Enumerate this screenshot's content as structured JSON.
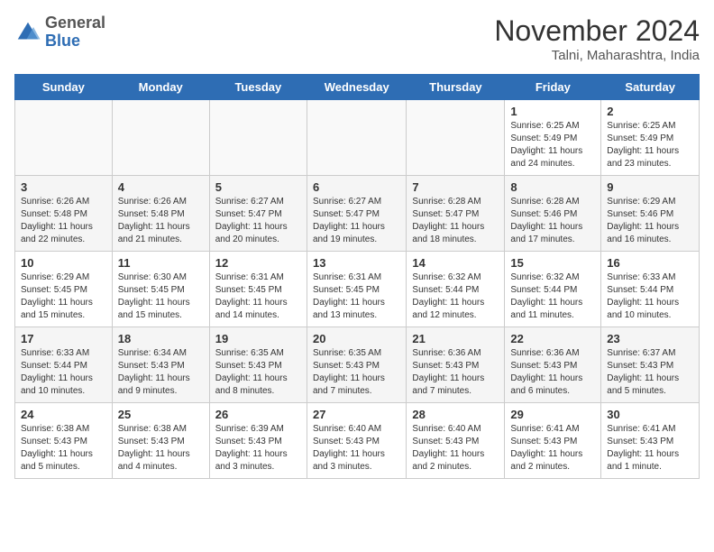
{
  "header": {
    "logo_general": "General",
    "logo_blue": "Blue",
    "month_title": "November 2024",
    "location": "Talni, Maharashtra, India"
  },
  "weekdays": [
    "Sunday",
    "Monday",
    "Tuesday",
    "Wednesday",
    "Thursday",
    "Friday",
    "Saturday"
  ],
  "weeks": [
    [
      {
        "day": "",
        "info": ""
      },
      {
        "day": "",
        "info": ""
      },
      {
        "day": "",
        "info": ""
      },
      {
        "day": "",
        "info": ""
      },
      {
        "day": "",
        "info": ""
      },
      {
        "day": "1",
        "info": "Sunrise: 6:25 AM\nSunset: 5:49 PM\nDaylight: 11 hours and 24 minutes."
      },
      {
        "day": "2",
        "info": "Sunrise: 6:25 AM\nSunset: 5:49 PM\nDaylight: 11 hours and 23 minutes."
      }
    ],
    [
      {
        "day": "3",
        "info": "Sunrise: 6:26 AM\nSunset: 5:48 PM\nDaylight: 11 hours and 22 minutes."
      },
      {
        "day": "4",
        "info": "Sunrise: 6:26 AM\nSunset: 5:48 PM\nDaylight: 11 hours and 21 minutes."
      },
      {
        "day": "5",
        "info": "Sunrise: 6:27 AM\nSunset: 5:47 PM\nDaylight: 11 hours and 20 minutes."
      },
      {
        "day": "6",
        "info": "Sunrise: 6:27 AM\nSunset: 5:47 PM\nDaylight: 11 hours and 19 minutes."
      },
      {
        "day": "7",
        "info": "Sunrise: 6:28 AM\nSunset: 5:47 PM\nDaylight: 11 hours and 18 minutes."
      },
      {
        "day": "8",
        "info": "Sunrise: 6:28 AM\nSunset: 5:46 PM\nDaylight: 11 hours and 17 minutes."
      },
      {
        "day": "9",
        "info": "Sunrise: 6:29 AM\nSunset: 5:46 PM\nDaylight: 11 hours and 16 minutes."
      }
    ],
    [
      {
        "day": "10",
        "info": "Sunrise: 6:29 AM\nSunset: 5:45 PM\nDaylight: 11 hours and 15 minutes."
      },
      {
        "day": "11",
        "info": "Sunrise: 6:30 AM\nSunset: 5:45 PM\nDaylight: 11 hours and 15 minutes."
      },
      {
        "day": "12",
        "info": "Sunrise: 6:31 AM\nSunset: 5:45 PM\nDaylight: 11 hours and 14 minutes."
      },
      {
        "day": "13",
        "info": "Sunrise: 6:31 AM\nSunset: 5:45 PM\nDaylight: 11 hours and 13 minutes."
      },
      {
        "day": "14",
        "info": "Sunrise: 6:32 AM\nSunset: 5:44 PM\nDaylight: 11 hours and 12 minutes."
      },
      {
        "day": "15",
        "info": "Sunrise: 6:32 AM\nSunset: 5:44 PM\nDaylight: 11 hours and 11 minutes."
      },
      {
        "day": "16",
        "info": "Sunrise: 6:33 AM\nSunset: 5:44 PM\nDaylight: 11 hours and 10 minutes."
      }
    ],
    [
      {
        "day": "17",
        "info": "Sunrise: 6:33 AM\nSunset: 5:44 PM\nDaylight: 11 hours and 10 minutes."
      },
      {
        "day": "18",
        "info": "Sunrise: 6:34 AM\nSunset: 5:43 PM\nDaylight: 11 hours and 9 minutes."
      },
      {
        "day": "19",
        "info": "Sunrise: 6:35 AM\nSunset: 5:43 PM\nDaylight: 11 hours and 8 minutes."
      },
      {
        "day": "20",
        "info": "Sunrise: 6:35 AM\nSunset: 5:43 PM\nDaylight: 11 hours and 7 minutes."
      },
      {
        "day": "21",
        "info": "Sunrise: 6:36 AM\nSunset: 5:43 PM\nDaylight: 11 hours and 7 minutes."
      },
      {
        "day": "22",
        "info": "Sunrise: 6:36 AM\nSunset: 5:43 PM\nDaylight: 11 hours and 6 minutes."
      },
      {
        "day": "23",
        "info": "Sunrise: 6:37 AM\nSunset: 5:43 PM\nDaylight: 11 hours and 5 minutes."
      }
    ],
    [
      {
        "day": "24",
        "info": "Sunrise: 6:38 AM\nSunset: 5:43 PM\nDaylight: 11 hours and 5 minutes."
      },
      {
        "day": "25",
        "info": "Sunrise: 6:38 AM\nSunset: 5:43 PM\nDaylight: 11 hours and 4 minutes."
      },
      {
        "day": "26",
        "info": "Sunrise: 6:39 AM\nSunset: 5:43 PM\nDaylight: 11 hours and 3 minutes."
      },
      {
        "day": "27",
        "info": "Sunrise: 6:40 AM\nSunset: 5:43 PM\nDaylight: 11 hours and 3 minutes."
      },
      {
        "day": "28",
        "info": "Sunrise: 6:40 AM\nSunset: 5:43 PM\nDaylight: 11 hours and 2 minutes."
      },
      {
        "day": "29",
        "info": "Sunrise: 6:41 AM\nSunset: 5:43 PM\nDaylight: 11 hours and 2 minutes."
      },
      {
        "day": "30",
        "info": "Sunrise: 6:41 AM\nSunset: 5:43 PM\nDaylight: 11 hours and 1 minute."
      }
    ]
  ]
}
